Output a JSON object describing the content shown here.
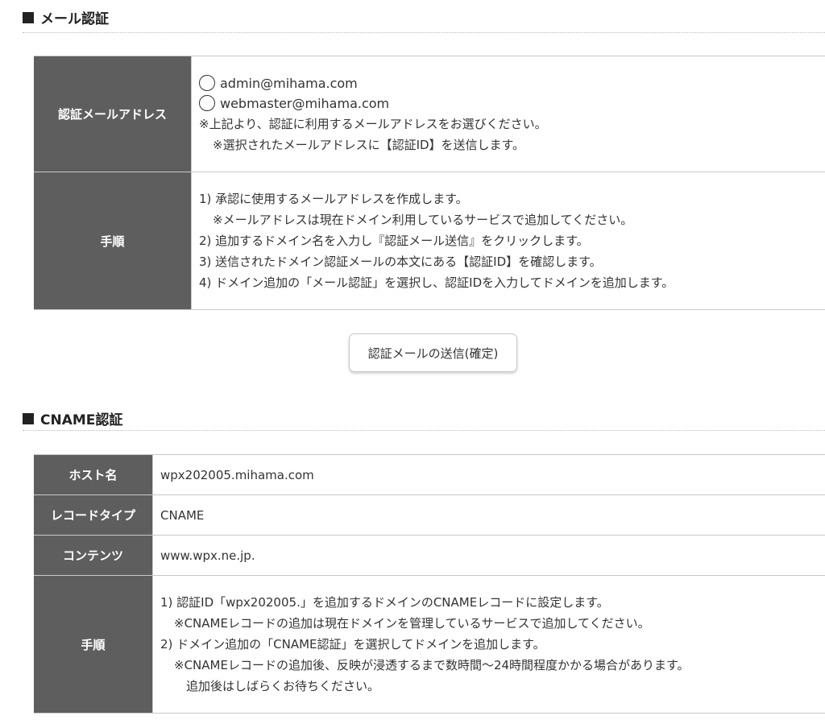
{
  "mail_auth": {
    "heading": "メール認証",
    "address_label": "認証メールアドレス",
    "options": [
      "admin@mihama.com",
      "webmaster@mihama.com"
    ],
    "notes": [
      "※上記より、認証に利用するメールアドレスをお選びください。",
      "※選択されたメールアドレスに【認証ID】を送信します。"
    ],
    "steps_label": "手順",
    "steps": [
      "1) 承認に使用するメールアドレスを作成します。",
      "※メールアドレスは現在ドメイン利用しているサービスで追加してください。",
      "2) 追加するドメイン名を入力し『認証メール送信』をクリックします。",
      "3) 送信されたドメイン認証メールの本文にある【認証ID】を確認します。",
      "4) ドメイン追加の「メール認証」を選択し、認証IDを入力してドメインを追加します。"
    ],
    "send_button": "認証メールの送信(確定)"
  },
  "cname_auth": {
    "heading": "CNAME認証",
    "rows": [
      {
        "label": "ホスト名",
        "value": "wpx202005.mihama.com"
      },
      {
        "label": "レコードタイプ",
        "value": "CNAME"
      },
      {
        "label": "コンテンツ",
        "value": "www.wpx.ne.jp."
      }
    ],
    "steps_label": "手順",
    "steps": [
      "1) 認証ID「wpx202005.」を追加するドメインのCNAMEレコードに設定します。",
      "※CNAMEレコードの追加は現在ドメインを管理しているサービスで追加してください。",
      "2) ドメイン追加の「CNAME認証」を選択してドメインを追加します。",
      "※CNAMEレコードの追加後、反映が浸透するまで数時間〜24時間程度かかる場合があります。",
      "追加後はしばらくお待ちください。"
    ]
  },
  "icons": {
    "heading_marker": "black-square-icon",
    "radio": "radio-unchecked-icon"
  }
}
